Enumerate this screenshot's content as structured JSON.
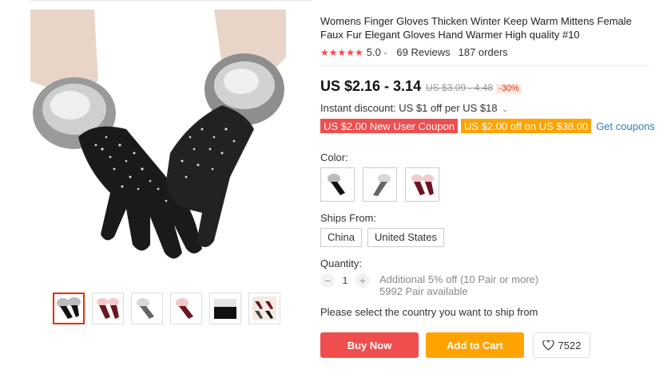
{
  "product": {
    "title": "Womens Finger Gloves Thicken Winter Keep Warm Mittens Female Faux Fur Elegant Gloves Hand Warmer High quality #10",
    "stars": "★★★★★",
    "rating": "5.0",
    "reviews": "69 Reviews",
    "orders": "187 orders",
    "price": "US $2.16 - 3.14",
    "old_price": "US $3.09 - 4.48",
    "discount": "-30%",
    "instant_discount": "Instant discount: US $1 off per US $18"
  },
  "coupons": {
    "new_user": "US $2.00 New User Coupon",
    "threshold": "US $2.00 off on US $38.00",
    "get_label": "Get coupons"
  },
  "options": {
    "color_label": "Color:",
    "colors": [
      "black",
      "gray",
      "wine red"
    ],
    "ships_from_label": "Ships From:",
    "ships_from": [
      "China",
      "United States"
    ],
    "quantity_label": "Quantity:",
    "quantity": "1",
    "minus": "−",
    "plus": "+",
    "additional_off": "Additional 5% off (10 Pair or more)",
    "available": "5992 Pair available",
    "ship_note": "Please select the country you want to ship from"
  },
  "actions": {
    "buy_now": "Buy Now",
    "add_to_cart": "Add to Cart",
    "wishlist_count": "7522"
  },
  "gallery": {
    "thumbnails": [
      "black gloves",
      "wine gloves",
      "gray gloves",
      "wine gloves single",
      "black fur closeup",
      "color set"
    ],
    "selected_index": 0
  },
  "colors": {
    "accent_red": "#f04e4e",
    "accent_orange": "#ffa300",
    "link_blue": "#2f7fb5"
  }
}
